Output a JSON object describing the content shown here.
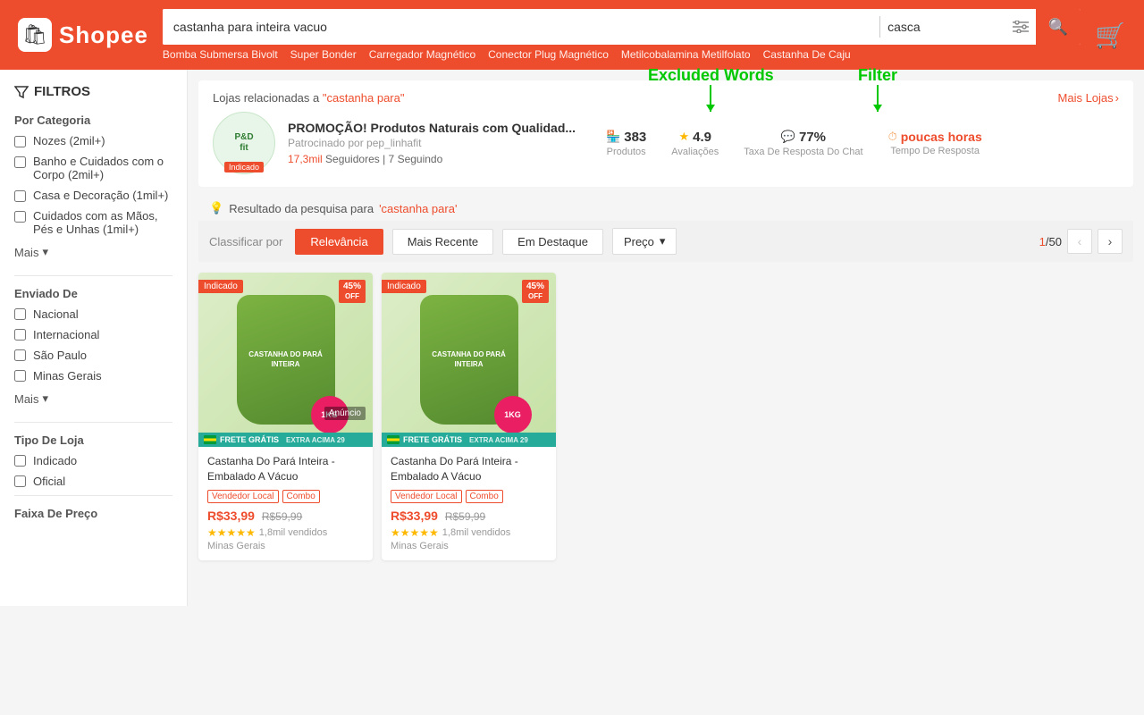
{
  "header": {
    "logo_text": "Shopee",
    "search_main_value": "castanha para inteira vacuo",
    "search_secondary_value": "casca",
    "search_btn_icon": "🔍",
    "cart_icon": "🛒",
    "suggestions": [
      "Bomba Submersa Bivolt",
      "Super Bonder",
      "Carregador Magnético",
      "Conector Plug Magnético",
      "Metilcobalamina Metilfolato",
      "Castanha De Caju"
    ]
  },
  "annotations": {
    "excluded_words_label": "Excluded Words",
    "filter_label": "Filter"
  },
  "sidebar": {
    "filters_title": "FILTROS",
    "categories_title": "Por Categoria",
    "categories": [
      {
        "label": "Nozes (2mil+)"
      },
      {
        "label": "Banho e Cuidados com o Corpo (2mil+)"
      },
      {
        "label": "Casa e Decoração (1mil+)"
      },
      {
        "label": "Cuidados com as Mãos, Pés e Unhas (1mil+)"
      }
    ],
    "more_label": "Mais",
    "enviado_de_title": "Enviado De",
    "shipping_options": [
      {
        "label": "Nacional"
      },
      {
        "label": "Internacional"
      },
      {
        "label": "São Paulo"
      },
      {
        "label": "Minas Gerais"
      }
    ],
    "tipo_loja_title": "Tipo De Loja",
    "store_types": [
      {
        "label": "Indicado"
      },
      {
        "label": "Oficial"
      }
    ],
    "faixa_preco_title": "Faixa De Preço"
  },
  "stores_section": {
    "header_text": "Lojas relacionadas a ",
    "search_term": "\"castanha para\"",
    "mais_lojas": "Mais Lojas",
    "store": {
      "name": "PROMOÇÃO! Produtos Naturais com Qualidad...",
      "sponsored": "Patrocinado por pep_linhafit",
      "badge": "Indicado",
      "followers": "17,3mil",
      "following": "7",
      "stats": [
        {
          "icon": "shop",
          "value": "383",
          "label": "Produtos"
        },
        {
          "icon": "star",
          "value": "4.9",
          "label": "Avaliações"
        },
        {
          "icon": "chat",
          "value": "77%",
          "label": "Taxa De Resposta Do Chat"
        },
        {
          "icon": "clock",
          "value": "poucas horas",
          "label": "Tempo De Resposta",
          "is_text": true
        }
      ]
    }
  },
  "results": {
    "header_text": "Resultado da pesquisa para ",
    "search_term": "'castanha para'",
    "sort_label": "Classificar por",
    "sort_options": [
      {
        "label": "Relevância",
        "active": true
      },
      {
        "label": "Mais Recente",
        "active": false
      },
      {
        "label": "Em Destaque",
        "active": false
      }
    ],
    "price_dropdown": "Preço",
    "page_current": "1",
    "page_total": "50",
    "prev_disabled": true,
    "products": [
      {
        "name": "Castanha Do Pará Inteira - Embalado A Vácuo",
        "tags": [
          "Vendedor Local",
          "Combo"
        ],
        "price": "R$33,99",
        "original_price": "R$59,99",
        "discount": "45%",
        "stars": "★★★★★",
        "sold": "1,8mil vendidos",
        "location": "Minas Gerais",
        "badge": "Indicado",
        "frete": true,
        "anuncio": true,
        "weight": "1KG"
      },
      {
        "name": "Castanha Do Pará Inteira - Embalado A Vácuo",
        "tags": [
          "Vendedor Local",
          "Combo"
        ],
        "price": "R$33,99",
        "original_price": "R$59,99",
        "discount": "45%",
        "stars": "★★★★★",
        "sold": "1,8mil vendidos",
        "location": "Minas Gerais",
        "badge": "Indicado",
        "frete": true,
        "anuncio": false,
        "weight": "1KG"
      }
    ]
  }
}
